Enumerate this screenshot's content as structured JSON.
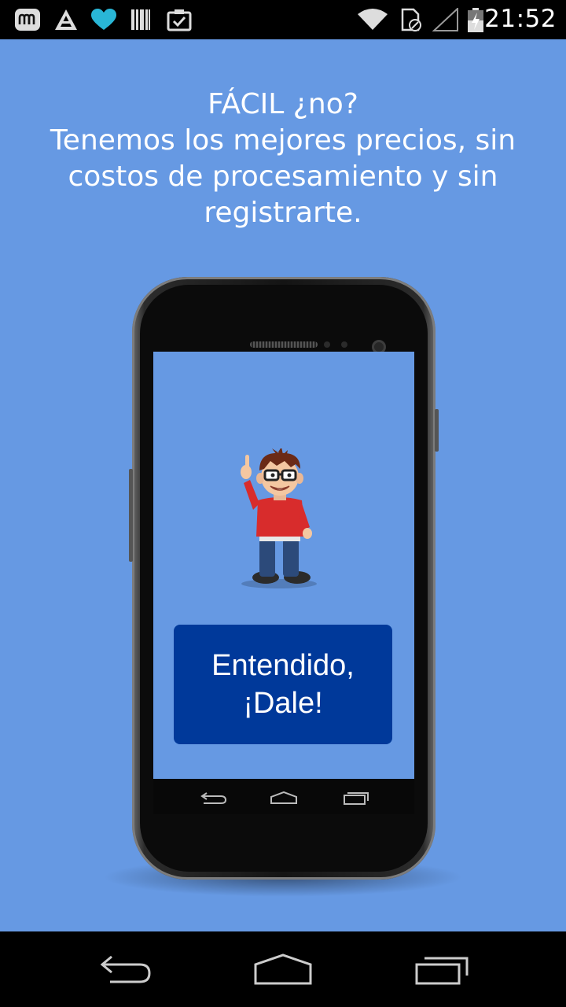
{
  "status_bar": {
    "time": "21:52",
    "left_icons": [
      "app-notification-icon",
      "triangle-app-icon",
      "heart-icon",
      "barcode-icon",
      "clipboard-check-icon"
    ],
    "right_icons": [
      "wifi-icon",
      "sim-card-icon",
      "signal-icon",
      "battery-charging-icon"
    ]
  },
  "content": {
    "title": "FÁCIL ¿no?",
    "subtitle_lines": [
      "Tenemos los mejores precios, sin",
      "costos de procesamiento y sin",
      "registrarte."
    ]
  },
  "illustration": {
    "phone_mockup": "phone-mockup",
    "character": "cartoon-character"
  },
  "cta_button": {
    "line1": "Entendido,",
    "line2": "¡Dale!"
  },
  "navigation": {
    "back": "back-icon",
    "home": "home-icon",
    "recents": "recent-apps-icon"
  },
  "colors": {
    "background": "#6699e3",
    "button": "#00399a",
    "text": "#ffffff"
  }
}
